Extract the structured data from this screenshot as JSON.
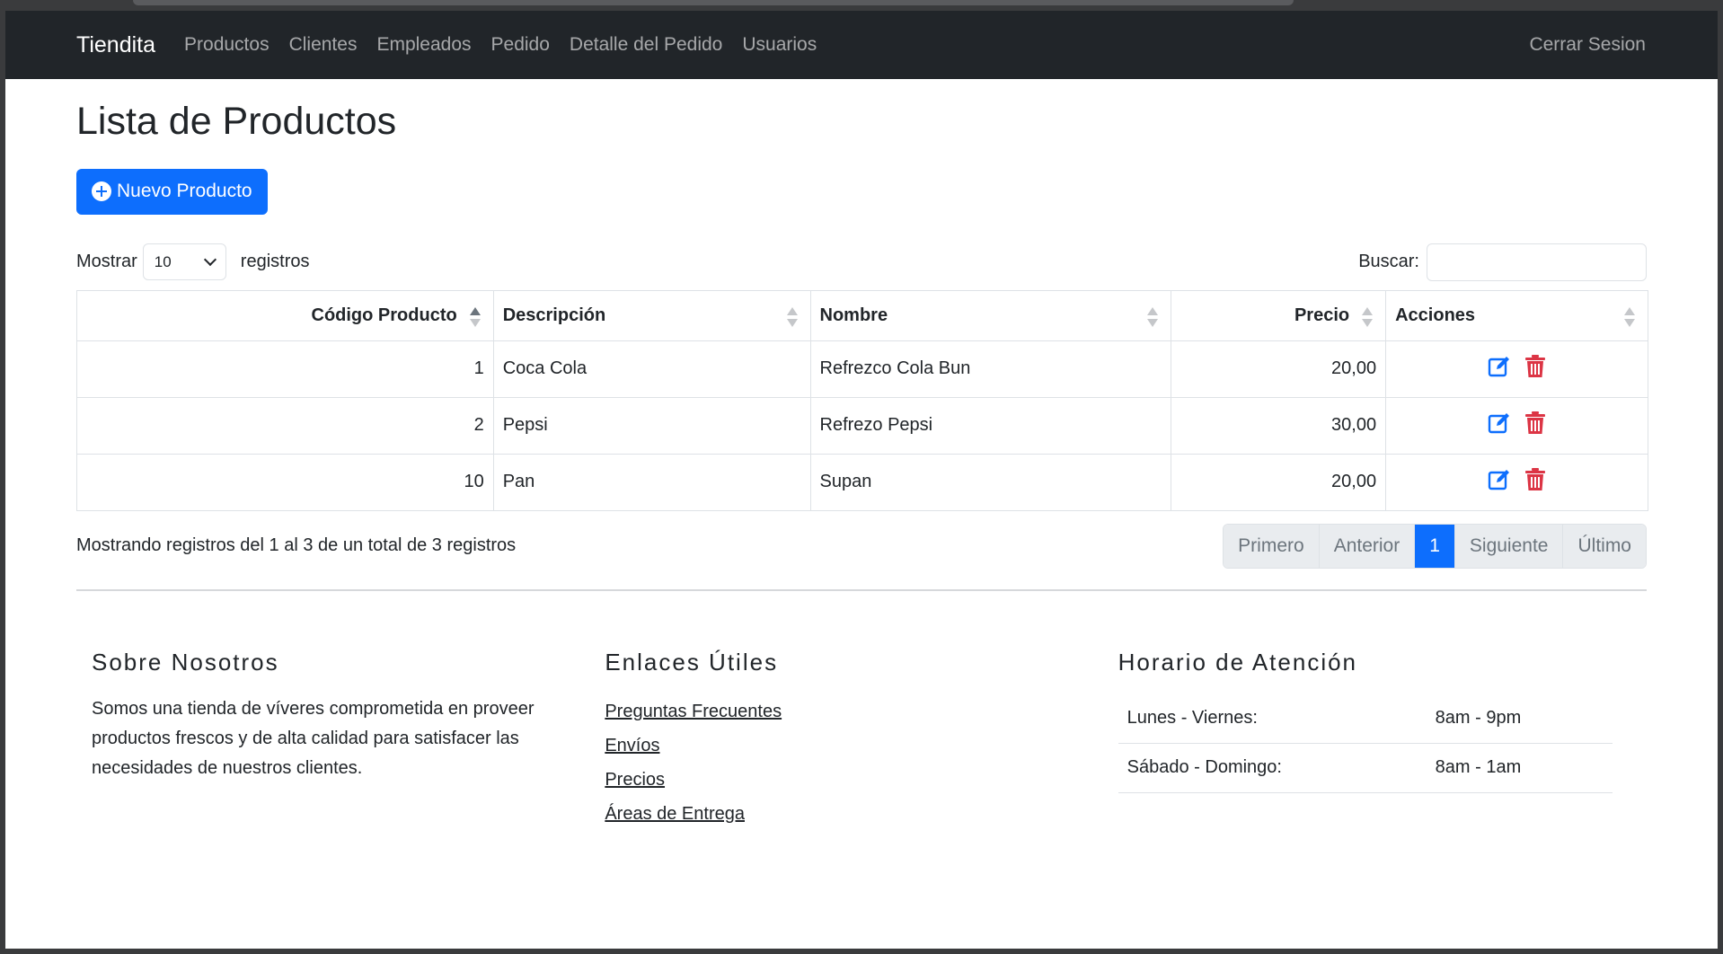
{
  "navbar": {
    "brand": "Tiendita",
    "links": [
      "Productos",
      "Clientes",
      "Empleados",
      "Pedido",
      "Detalle del Pedido",
      "Usuarios"
    ],
    "logout": "Cerrar Sesion"
  },
  "page": {
    "title": "Lista de Productos",
    "new_button": "Nuevo Producto"
  },
  "controls": {
    "show_label": "Mostrar",
    "page_size": "10",
    "records_label": "registros",
    "search_label": "Buscar:",
    "search_value": ""
  },
  "table": {
    "headers": [
      "Código Producto",
      "Descripción",
      "Nombre",
      "Precio",
      "Acciones"
    ],
    "rows": [
      {
        "codigo": "1",
        "descripcion": "Coca Cola",
        "nombre": "Refrezco Cola Bun",
        "precio": "20,00"
      },
      {
        "codigo": "2",
        "descripcion": "Pepsi",
        "nombre": "Refrezo Pepsi",
        "precio": "30,00"
      },
      {
        "codigo": "10",
        "descripcion": "Pan",
        "nombre": "Supan",
        "precio": "20,00"
      }
    ]
  },
  "summary": "Mostrando registros del 1 al 3 de un total de 3 registros",
  "pagination": {
    "first": "Primero",
    "prev": "Anterior",
    "current": "1",
    "next": "Siguiente",
    "last": "Último"
  },
  "footer": {
    "about_title": "Sobre Nosotros",
    "about_text": "Somos una tienda de víveres comprometida en proveer productos frescos y de alta calidad para satisfacer las necesidades de nuestros clientes.",
    "links_title": "Enlaces Útiles",
    "links": [
      "Preguntas Frecuentes",
      "Envíos",
      "Precios",
      "Áreas de Entrega"
    ],
    "hours_title": "Horario de Atención",
    "hours": [
      {
        "day": "Lunes - Viernes:",
        "time": "8am - 9pm"
      },
      {
        "day": "Sábado - Domingo:",
        "time": "8am - 1am"
      }
    ]
  },
  "colors": {
    "primary": "#0d6efd",
    "danger": "#dc3545",
    "navbar": "#212529"
  }
}
